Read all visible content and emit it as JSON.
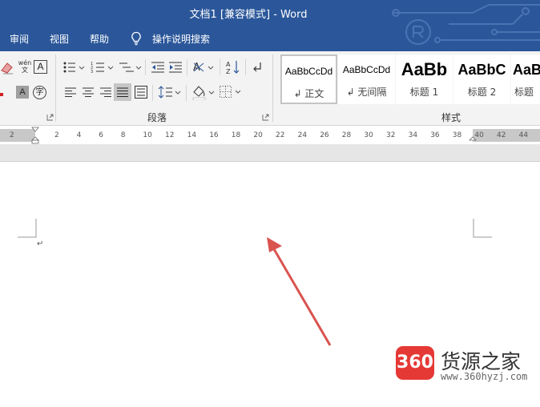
{
  "window": {
    "title": "文档1 [兼容模式]  -  Word"
  },
  "tabs": [
    {
      "label": "审阅"
    },
    {
      "label": "视图"
    },
    {
      "label": "帮助"
    }
  ],
  "tell_me": {
    "label": "操作说明搜索",
    "icon": "lightbulb-icon"
  },
  "ribbon": {
    "groups": {
      "paragraph": "段落",
      "styles": "样式"
    },
    "styles": [
      {
        "sample": "AaBbCcDd",
        "name": "↲ 正文",
        "selected": true
      },
      {
        "sample": "AaBbCcDd",
        "name": "↲ 无间隔",
        "selected": false
      },
      {
        "sample": "AaBb",
        "name": "标题 1",
        "selected": false
      },
      {
        "sample": "AaBbC",
        "name": "标题 2",
        "selected": false
      },
      {
        "sample": "AaB",
        "name": "标题",
        "selected": false
      }
    ],
    "font_tools": {
      "phonetic": "wén\n文",
      "char_border": "A",
      "shade": "A",
      "enclose": "字"
    }
  },
  "ruler": {
    "ticks": [
      "2",
      "2",
      "4",
      "6",
      "8",
      "10",
      "12",
      "14",
      "16",
      "18",
      "20",
      "22",
      "24",
      "26",
      "28",
      "30",
      "32",
      "34",
      "36",
      "38",
      "40",
      "42",
      "44"
    ]
  },
  "document": {
    "paragraph_mark": "↵"
  },
  "watermark": {
    "badge": "360",
    "brand": "货源之家",
    "url": "www.360hyzj.com"
  },
  "colors": {
    "title_bar": "#2b579a",
    "ribbon_bg": "#f3f3f3",
    "arrow": "#d9534f",
    "badge": "#e53935"
  }
}
